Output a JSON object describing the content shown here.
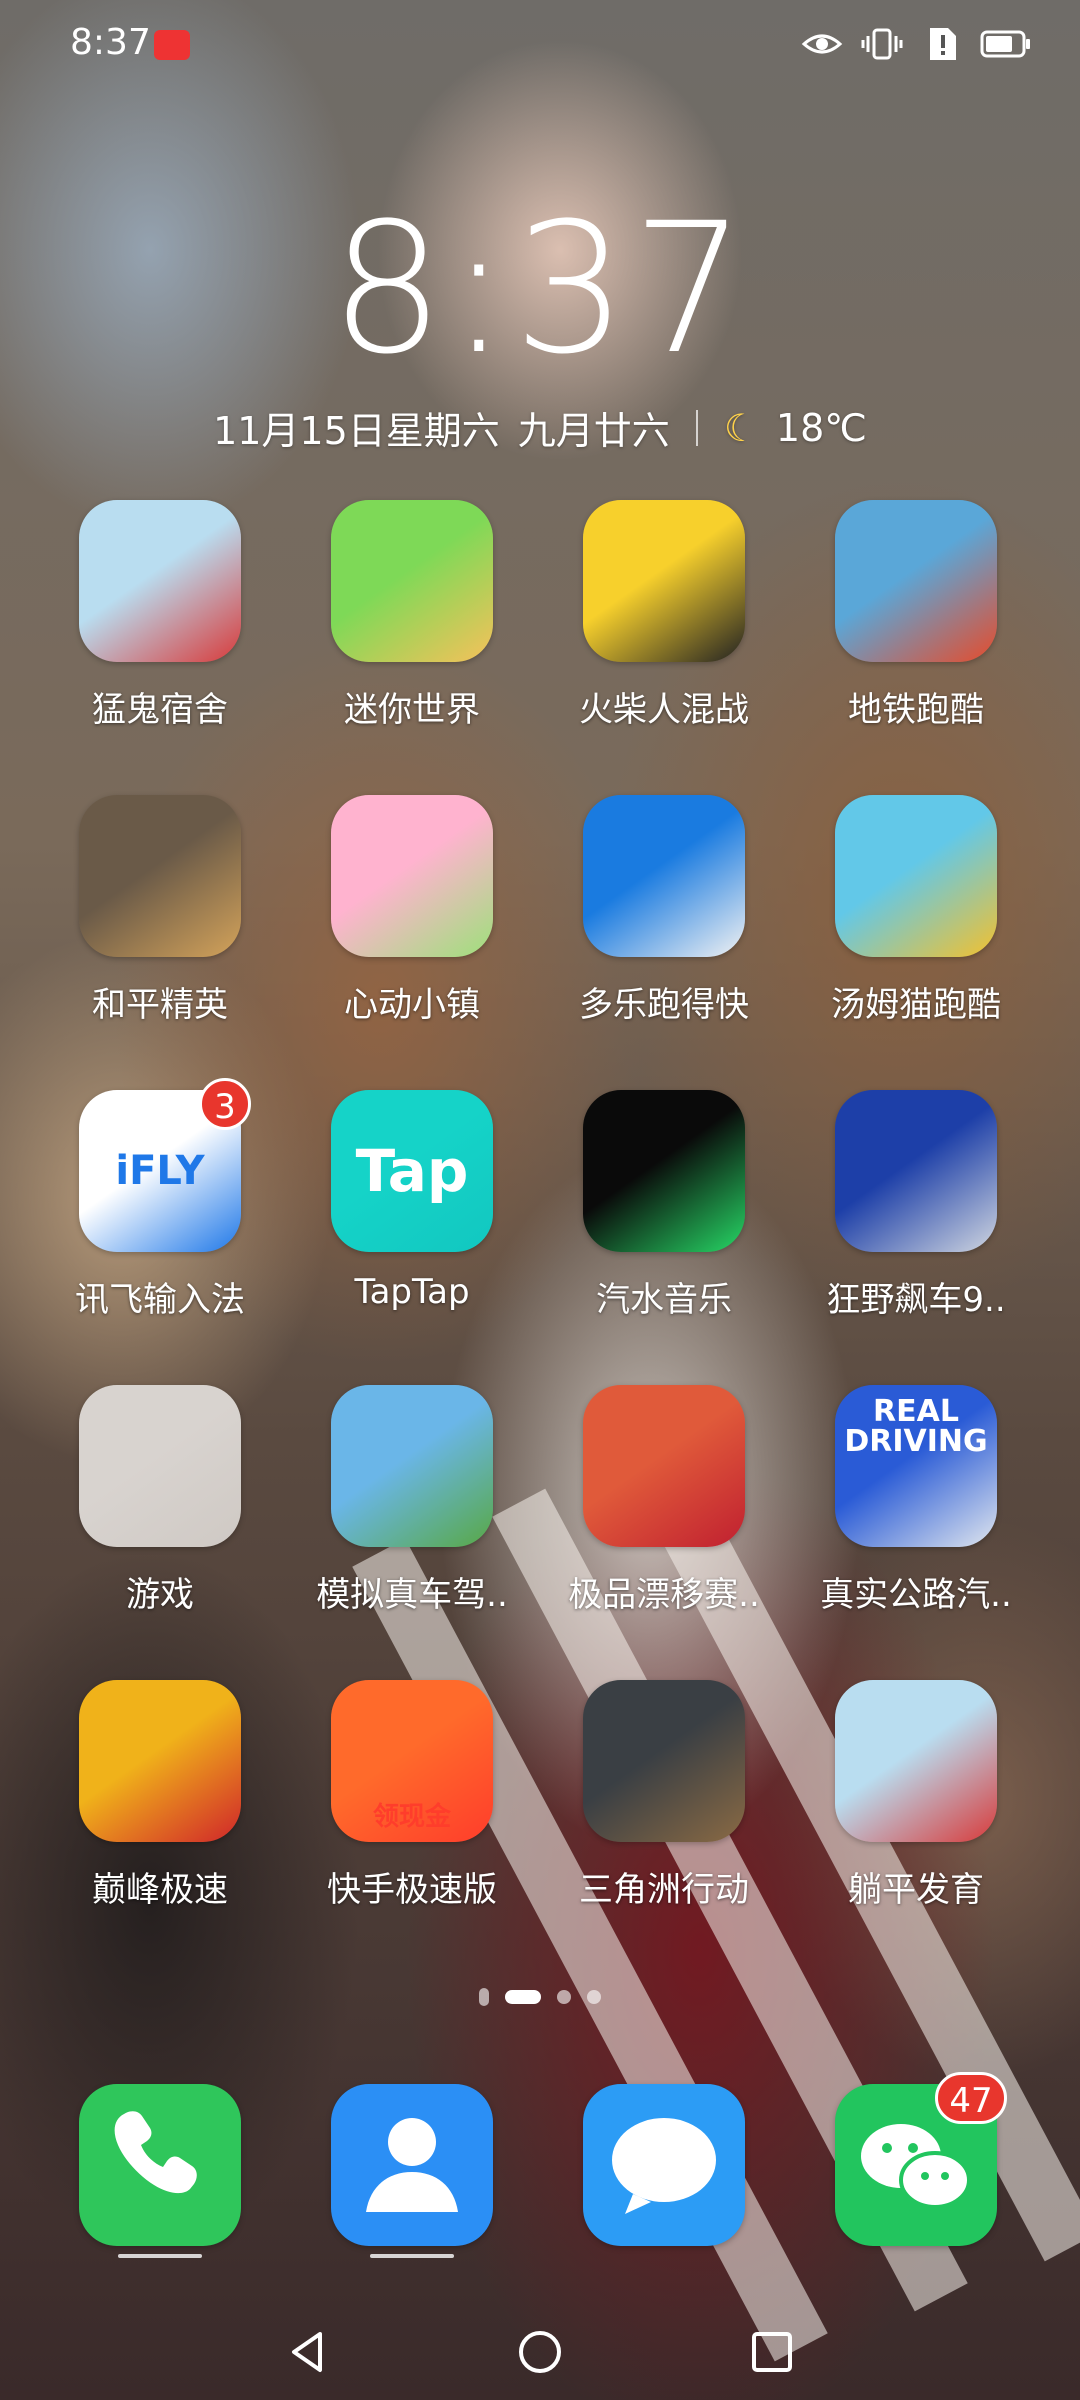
{
  "status_bar": {
    "time": "8:37"
  },
  "lock": {
    "clock": "8:37",
    "date": "11月15日星期六",
    "lunar": "九月廿六",
    "weather_icon": "moon-icon",
    "temperature": "18℃"
  },
  "apps": [
    {
      "label": "猛鬼宿舍",
      "color_a": "#b9ddf0",
      "color_b": "#d83a3a"
    },
    {
      "label": "迷你世界",
      "color_a": "#7ed957",
      "color_b": "#f6c15a"
    },
    {
      "label": "火柴人混战",
      "color_a": "#f7d02c",
      "color_b": "#222222"
    },
    {
      "label": "地铁跑酷",
      "color_a": "#5aa7d8",
      "color_b": "#e64b2b"
    },
    {
      "label": "和平精英",
      "color_a": "#6a5a48",
      "color_b": "#d4a35a"
    },
    {
      "label": "心动小镇",
      "color_a": "#ffb3cf",
      "color_b": "#9de07a"
    },
    {
      "label": "多乐跑得快",
      "color_a": "#1a7be0",
      "color_b": "#f2f2f2"
    },
    {
      "label": "汤姆猫跑酷",
      "color_a": "#62c8e8",
      "color_b": "#f3c12e"
    },
    {
      "label": "讯飞输入法",
      "color_a": "#ffffff",
      "color_b": "#1f78e8",
      "badge": "3",
      "icon_text": "iFLY"
    },
    {
      "label": "TapTap",
      "color_a": "#15d3c8",
      "color_b": "#12c7c0",
      "icon_text": "Tap"
    },
    {
      "label": "汽水音乐",
      "color_a": "#0a0a0a",
      "color_b": "#27d866"
    },
    {
      "label": "狂野飙车9..",
      "color_a": "#1d3fa8",
      "color_b": "#d0d6e0"
    },
    {
      "label": "游戏",
      "color_a": "#d8d3cf",
      "color_b": "#cfc9c4"
    },
    {
      "label": "模拟真车驾..",
      "color_a": "#6ab6e8",
      "color_b": "#58a845"
    },
    {
      "label": "极品漂移赛..",
      "color_a": "#e05a3a",
      "color_b": "#c02030"
    },
    {
      "label": "真实公路汽..",
      "color_a": "#2a5bd6",
      "color_b": "#e0e6ee",
      "icon_text": "REAL DRIVING"
    },
    {
      "label": "巅峰极速",
      "color_a": "#f0b21a",
      "color_b": "#d0252a"
    },
    {
      "label": "快手极速版",
      "color_a": "#ff6a2b",
      "color_b": "#ff3d2b",
      "icon_text": "领现金"
    },
    {
      "label": "三角洲行动",
      "color_a": "#3a3f44",
      "color_b": "#8a6a44"
    },
    {
      "label": "躺平发育",
      "color_a": "#b9ddf0",
      "color_b": "#d83a3a"
    }
  ],
  "dock": [
    {
      "name": "phone",
      "color": "#2fc65b",
      "icon": "phone-icon"
    },
    {
      "name": "contacts",
      "color": "#2b8ff5",
      "icon": "person-icon"
    },
    {
      "name": "messages",
      "color": "#2c9cf5",
      "icon": "message-icon"
    },
    {
      "name": "wechat",
      "color": "#22c55e",
      "icon": "wechat-icon",
      "badge": "47"
    }
  ],
  "page_indicator": {
    "count": 3,
    "active": 1
  }
}
